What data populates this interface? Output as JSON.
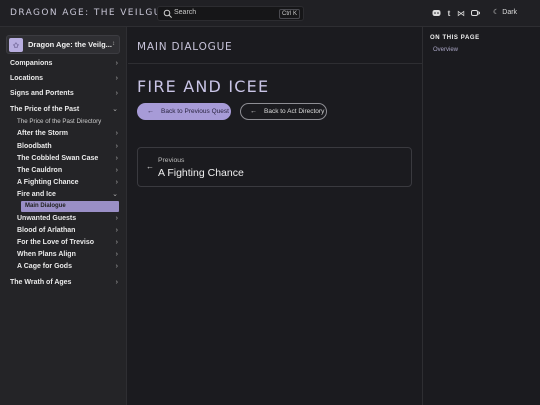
{
  "header": {
    "site_title": "DRAGON AGE: THE VEILGUARD",
    "search_placeholder": "Search",
    "search_shortcut": "Ctrl K",
    "social_icons": [
      "discord-icon",
      "tumblr-icon",
      "bluesky-icon",
      "ko-fi-icon"
    ],
    "theme_label": "Dark"
  },
  "sidebar": {
    "selector_label": "Dragon Age: the Veilg...",
    "items": [
      {
        "label": "Companions"
      },
      {
        "label": "Locations"
      },
      {
        "label": "Signs and Portents"
      },
      {
        "label": "The Price of the Past"
      },
      {
        "label": "The Price of the Past Directory"
      },
      {
        "label": "After the Storm"
      },
      {
        "label": "Bloodbath"
      },
      {
        "label": "The Cobbled Swan Case"
      },
      {
        "label": "The Cauldron"
      },
      {
        "label": "A Fighting Chance"
      },
      {
        "label": "Fire and Ice"
      },
      {
        "label": "Main Dialogue"
      },
      {
        "label": "Unwanted Guests"
      },
      {
        "label": "Blood of Arlathan"
      },
      {
        "label": "For the Love of Treviso"
      },
      {
        "label": "When Plans Align"
      },
      {
        "label": "A Cage for Gods"
      },
      {
        "label": "The Wrath of Ages"
      }
    ]
  },
  "main": {
    "breadcrumb": "MAIN DIALOGUE",
    "title": "FIRE AND ICEE",
    "back_quest_label": "Back to Previous Quest",
    "back_directory_label": "Back to Act Directory",
    "prev_label": "Previous",
    "prev_title": "A Fighting Chance"
  },
  "aside": {
    "heading": "ON THIS PAGE",
    "links": [
      "Overview"
    ]
  },
  "colors": {
    "accent": "#a79bd7",
    "background": "#1b1b1f",
    "sidebar_bg": "#242427"
  }
}
